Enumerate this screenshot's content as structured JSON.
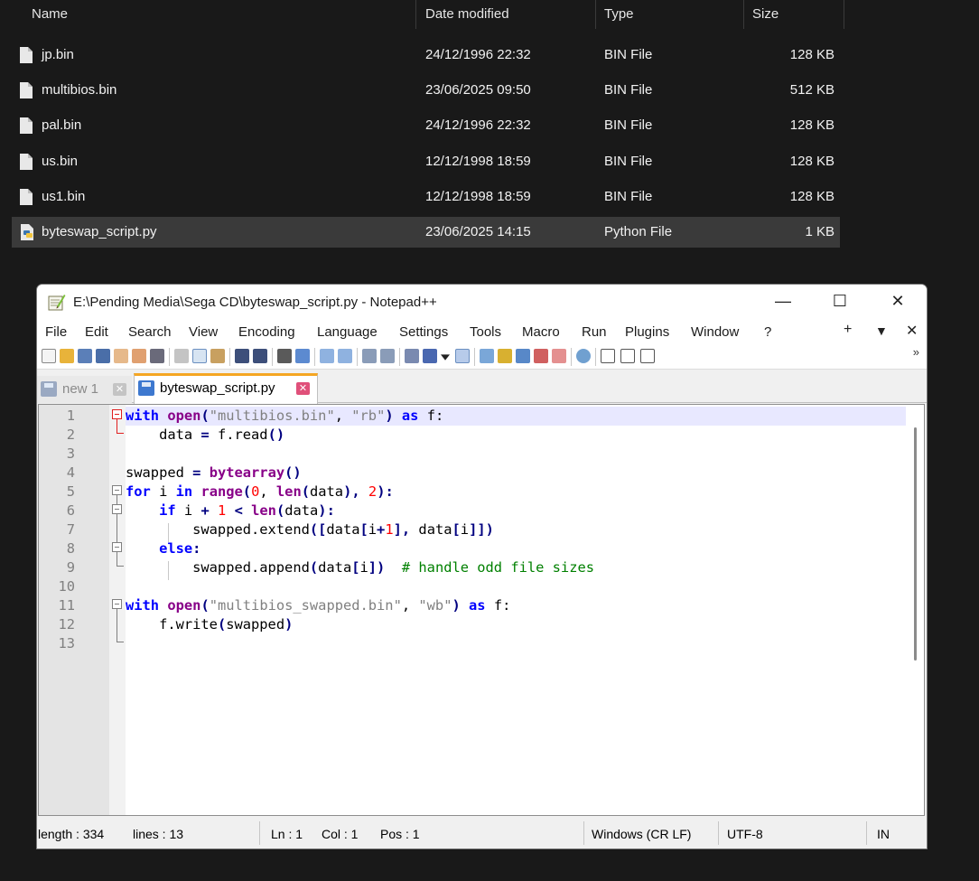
{
  "explorer": {
    "columns": {
      "name": "Name",
      "date": "Date modified",
      "type": "Type",
      "size": "Size"
    },
    "sort_indicator": "^",
    "files": [
      {
        "name": "jp.bin",
        "date": "24/12/1996 22:32",
        "type": "BIN File",
        "size": "128 KB",
        "icon": "file-icon"
      },
      {
        "name": "multibios.bin",
        "date": "23/06/2025 09:50",
        "type": "BIN File",
        "size": "512 KB",
        "icon": "file-icon"
      },
      {
        "name": "pal.bin",
        "date": "24/12/1996 22:32",
        "type": "BIN File",
        "size": "128 KB",
        "icon": "file-icon"
      },
      {
        "name": "us.bin",
        "date": "12/12/1998 18:59",
        "type": "BIN File",
        "size": "128 KB",
        "icon": "file-icon"
      },
      {
        "name": "us1.bin",
        "date": "12/12/1998 18:59",
        "type": "BIN File",
        "size": "128 KB",
        "icon": "file-icon"
      },
      {
        "name": "byteswap_script.py",
        "date": "23/06/2025 14:15",
        "type": "Python File",
        "size": "1 KB",
        "icon": "python-file-icon",
        "selected": true
      }
    ]
  },
  "notepad": {
    "title": "E:\\Pending Media\\Sega CD\\byteswap_script.py - Notepad++",
    "window_controls": {
      "minimize": "—",
      "maximize": "☐",
      "close": "✕"
    },
    "menu": [
      "File",
      "Edit",
      "Search",
      "View",
      "Encoding",
      "Language",
      "Settings",
      "Tools",
      "Macro",
      "Run",
      "Plugins",
      "Window",
      "?"
    ],
    "menu_right": {
      "add": "+",
      "dropdown": "▼",
      "close": "✕"
    },
    "toolbar_more": "»",
    "tabs": [
      {
        "label": "new 1",
        "active": false,
        "close": "✕"
      },
      {
        "label": "byteswap_script.py",
        "active": true,
        "close": "✕"
      }
    ],
    "line_numbers": [
      "1",
      "2",
      "3",
      "4",
      "5",
      "6",
      "7",
      "8",
      "9",
      "10",
      "11",
      "12",
      "13"
    ],
    "status": {
      "length": "length : 334",
      "lines": "lines : 13",
      "ln": "Ln : 1",
      "col": "Col : 1",
      "pos": "Pos : 1",
      "eol": "Windows (CR LF)",
      "encoding": "UTF-8",
      "mode": "IN"
    },
    "accent_colors": {
      "tab_active_top": "#f5a623",
      "current_line": "#e8e8ff",
      "keyword": "#0000ff",
      "builtin": "#880088",
      "string": "#808080",
      "number": "#ff0000",
      "comment": "#008000"
    }
  },
  "code": {
    "l1": {
      "kw1": "with",
      "fn": "open",
      "p1": "(",
      "s1": "\"multibios.bin\"",
      "c1": ", ",
      "s2": "\"rb\"",
      "p2": ")",
      "kw2": "as",
      "rest": " f:"
    },
    "l2": {
      "a": "    data ",
      "eq": "=",
      "b": " f.read",
      "par": "()"
    },
    "l4": {
      "a": "swapped ",
      "eq": "=",
      "fn": "bytearray",
      "par": "()"
    },
    "l5": {
      "kw1": "for",
      "a": " i ",
      "kw2": "in",
      "fn": "range",
      "p1": "(",
      "n": "0",
      "c": ", ",
      "fn2": "len",
      "p2": "(",
      "arg": "data",
      "p3": "),",
      "n2": "2",
      "p4": "):"
    },
    "l6": {
      "ind": "    ",
      "kw": "if",
      "a": " i ",
      "plus": "+",
      "n": "1",
      "lt": "<",
      "fn": "len",
      "p1": "(",
      "arg": "data",
      "p2": "):"
    },
    "l7": {
      "a": "        swapped.extend",
      "p1": "([",
      "b": "data",
      "p2": "[",
      "c": "i",
      "plus": "+",
      "n": "1",
      "p3": "],",
      "d": " data",
      "p4": "[",
      "e": "i",
      "p5": "]])"
    },
    "l8": {
      "ind": "    ",
      "kw": "else",
      "p": ":"
    },
    "l9": {
      "a": "        swapped.append",
      "p1": "(",
      "b": "data",
      "p2": "[",
      "c": "i",
      "p3": "])",
      "cmt": "# handle odd file sizes"
    },
    "l11": {
      "kw1": "with",
      "fn": "open",
      "p1": "(",
      "s1": "\"multibios_swapped.bin\"",
      "c1": ", ",
      "s2": "\"wb\"",
      "p2": ")",
      "kw2": "as",
      "rest": " f:"
    },
    "l12": {
      "a": "    f.write",
      "p1": "(",
      "b": "swapped",
      "p2": ")"
    }
  }
}
